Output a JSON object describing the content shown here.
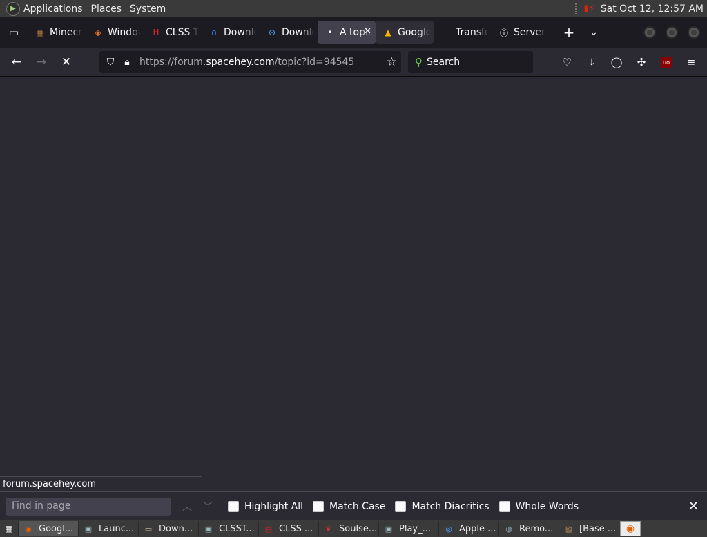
{
  "system_panel": {
    "menus": [
      "Applications",
      "Places",
      "System"
    ],
    "clock": "Sat Oct 12, 12:57 AM"
  },
  "tabs": [
    {
      "title": "Minecraft",
      "icon": "minecraft-icon",
      "icon_glyph": "▦",
      "icon_color": "#a0703a"
    },
    {
      "title": "Windows",
      "icon": "diamond-icon",
      "icon_glyph": "◈",
      "icon_color": "#e8762d"
    },
    {
      "title": "CLSS T",
      "icon": "h-logo-icon",
      "icon_glyph": "H",
      "icon_color": "#e0252b"
    },
    {
      "title": "Download",
      "icon": "n-logo-icon",
      "icon_glyph": "∩",
      "icon_color": "#3a7cf0"
    },
    {
      "title": "Download",
      "icon": "o-logo-icon",
      "icon_glyph": "⊙",
      "icon_color": "#5aa0ff"
    },
    {
      "title": "A topic",
      "icon": "loading-dot-icon",
      "icon_glyph": "•",
      "icon_color": "#fbfbfe",
      "active": true
    },
    {
      "title": "Google",
      "icon": "google-drive-icon",
      "icon_glyph": "▲",
      "icon_color": "#f4b400"
    },
    {
      "title": "Transfer",
      "icon": "apple-icon",
      "icon_glyph": "",
      "icon_color": "#cccccc"
    },
    {
      "title": "Server",
      "icon": "info-icon",
      "icon_glyph": "ⓘ",
      "icon_color": "#fbfbfe"
    }
  ],
  "navbar": {
    "url_prefix": "https://forum.",
    "url_host": "spacehey.com",
    "url_path": "/topic?id=94545",
    "search_placeholder": "Search"
  },
  "status_link": "forum.spacehey.com",
  "findbar": {
    "placeholder": "Find in page",
    "options": [
      "Highlight All",
      "Match Case",
      "Match Diacritics",
      "Whole Words"
    ]
  },
  "taskbar": [
    {
      "label": "Googl...",
      "icon": "firefox-icon",
      "glyph": "◉",
      "color": "#e66000",
      "active": true
    },
    {
      "label": "Launc...",
      "icon": "window-icon",
      "glyph": "▣",
      "color": "#9bb"
    },
    {
      "label": "Down...",
      "icon": "folder-icon",
      "glyph": "▭",
      "color": "#cfc8a0"
    },
    {
      "label": "CLSST...",
      "icon": "window-icon",
      "glyph": "▣",
      "color": "#9bb"
    },
    {
      "label": "CLSS ...",
      "icon": "pdf-icon",
      "glyph": "▤",
      "color": "#d22"
    },
    {
      "label": "Soulse...",
      "icon": "soulseek-icon",
      "glyph": "❦",
      "color": "#c33"
    },
    {
      "label": "Play_...",
      "icon": "window-icon",
      "glyph": "▣",
      "color": "#9bb"
    },
    {
      "label": "Apple ...",
      "icon": "apple-music-icon",
      "glyph": "◎",
      "color": "#4aa3ff"
    },
    {
      "label": "Remo...",
      "icon": "remote-icon",
      "glyph": "◍",
      "color": "#8ab"
    },
    {
      "label": "[Base ...",
      "icon": "terminal-icon",
      "glyph": "▧",
      "color": "#b58a5a"
    }
  ]
}
